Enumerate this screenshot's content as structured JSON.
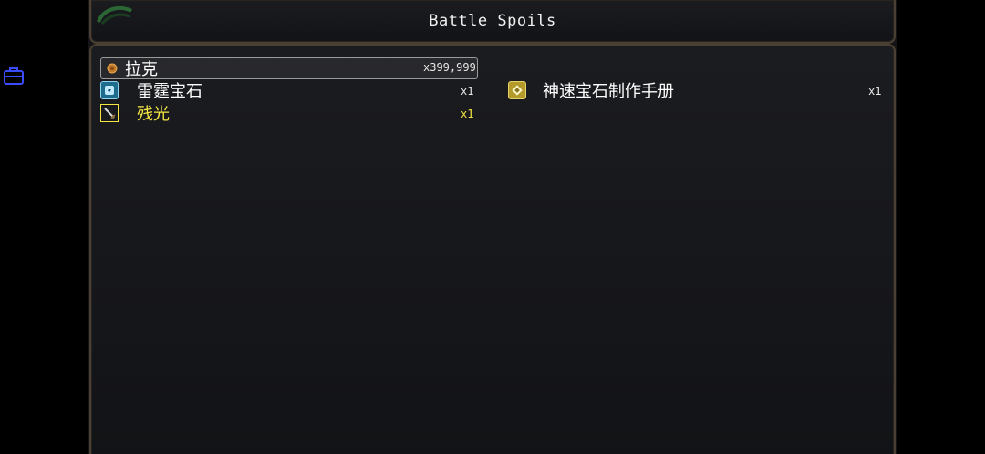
{
  "window_title": "Battle Spoils",
  "items": [
    {
      "name": "拉克",
      "qty": "x399,999",
      "icon": "coin-icon",
      "color": "#ffffff"
    },
    {
      "name": "雷霆宝石",
      "qty": "x1",
      "icon": "thunder-gem-icon",
      "color": "#ffffff"
    },
    {
      "name": "残光",
      "qty": "x1",
      "icon": "sword-icon",
      "color": "#f5e642"
    },
    {
      "name": "神速宝石制作手册",
      "qty": "x1",
      "icon": "manual-icon",
      "color": "#ffffff"
    }
  ],
  "colors": {
    "rare_item": "#f5e642",
    "window_border": "#4a3f33",
    "side_icon": "#3b4bff"
  }
}
